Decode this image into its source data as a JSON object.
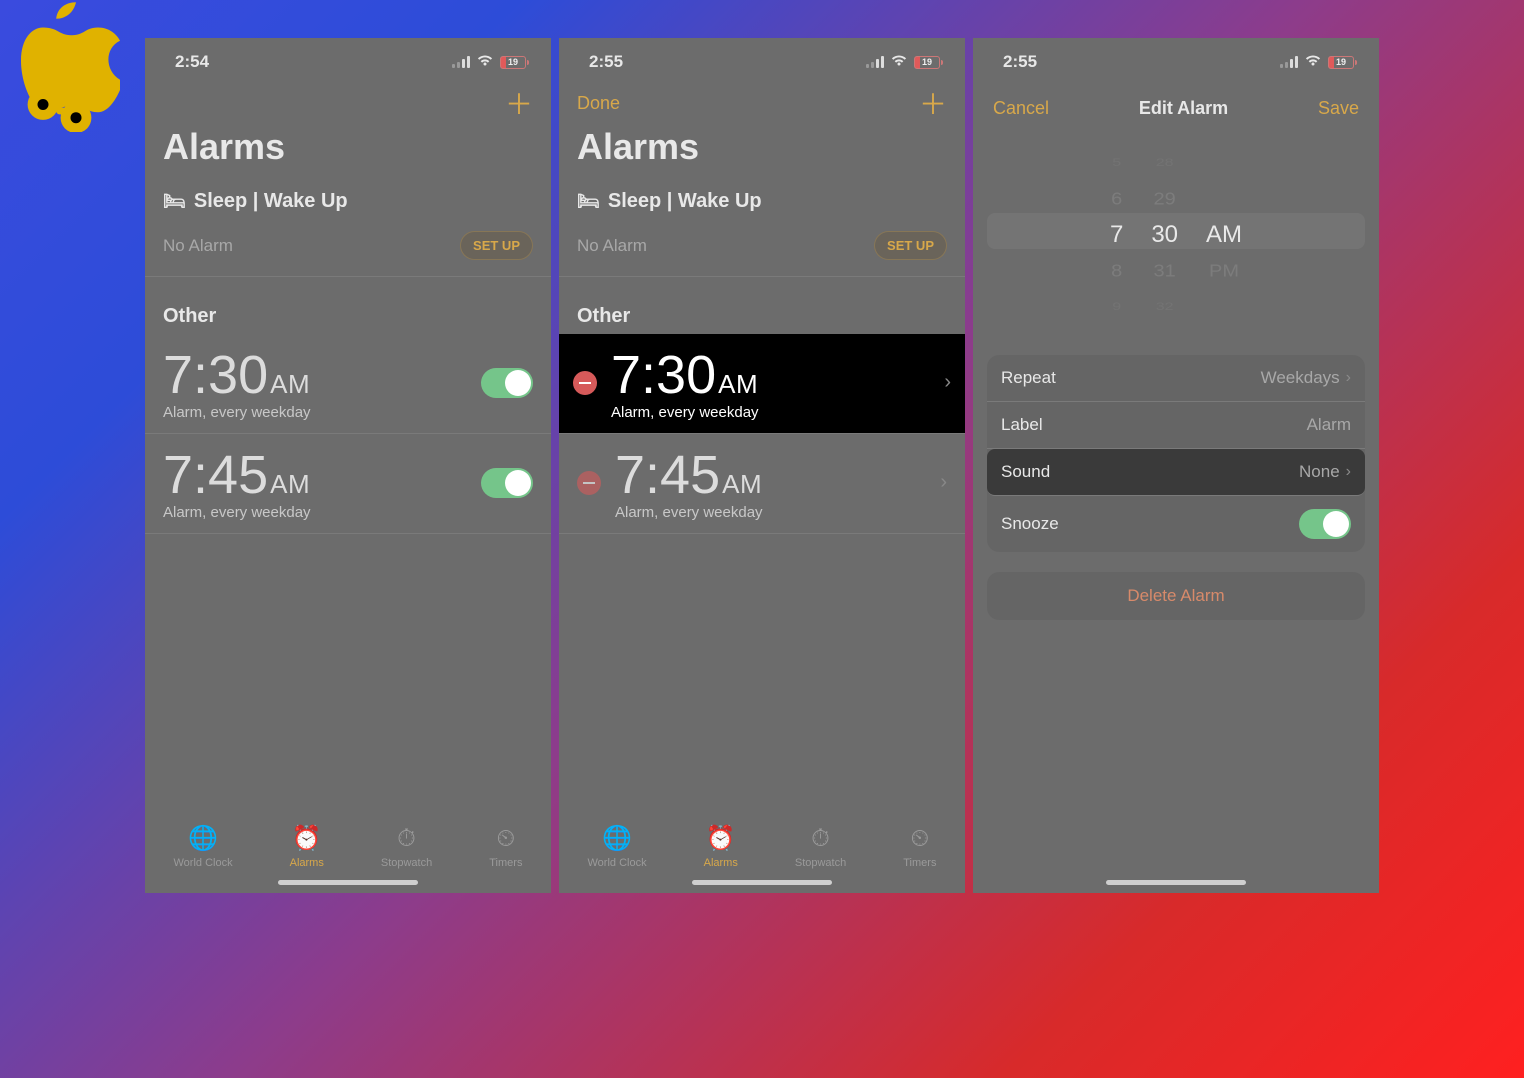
{
  "statusbar": {
    "time1": "2:54",
    "time2": "2:55",
    "time3": "2:55",
    "battery": "19"
  },
  "panel1": {
    "title": "Alarms",
    "sleep_header": "Sleep | Wake Up",
    "no_alarm": "No Alarm",
    "setup": "SET UP",
    "other": "Other",
    "alarms": [
      {
        "time": "7:30",
        "ampm": "AM",
        "sub": "Alarm, every weekday"
      },
      {
        "time": "7:45",
        "ampm": "AM",
        "sub": "Alarm, every weekday"
      }
    ]
  },
  "panel2": {
    "done": "Done",
    "title": "Alarms",
    "sleep_header": "Sleep | Wake Up",
    "no_alarm": "No Alarm",
    "setup": "SET UP",
    "other": "Other",
    "alarms": [
      {
        "time": "7:30",
        "ampm": "AM",
        "sub": "Alarm, every weekday",
        "selected": true
      },
      {
        "time": "7:45",
        "ampm": "AM",
        "sub": "Alarm, every weekday",
        "selected": false
      }
    ]
  },
  "panel3": {
    "cancel": "Cancel",
    "title": "Edit Alarm",
    "save": "Save",
    "picker": {
      "hours": [
        "5",
        "6",
        "7",
        "8",
        "9"
      ],
      "minutes": [
        "28",
        "29",
        "30",
        "31",
        "32"
      ],
      "ampm": [
        "AM",
        "PM"
      ]
    },
    "settings": {
      "repeat_label": "Repeat",
      "repeat_value": "Weekdays",
      "label_label": "Label",
      "label_value": "Alarm",
      "sound_label": "Sound",
      "sound_value": "None",
      "snooze_label": "Snooze"
    },
    "delete": "Delete Alarm"
  },
  "tabs": {
    "world": "World Clock",
    "alarms": "Alarms",
    "stopwatch": "Stopwatch",
    "timers": "Timers"
  }
}
